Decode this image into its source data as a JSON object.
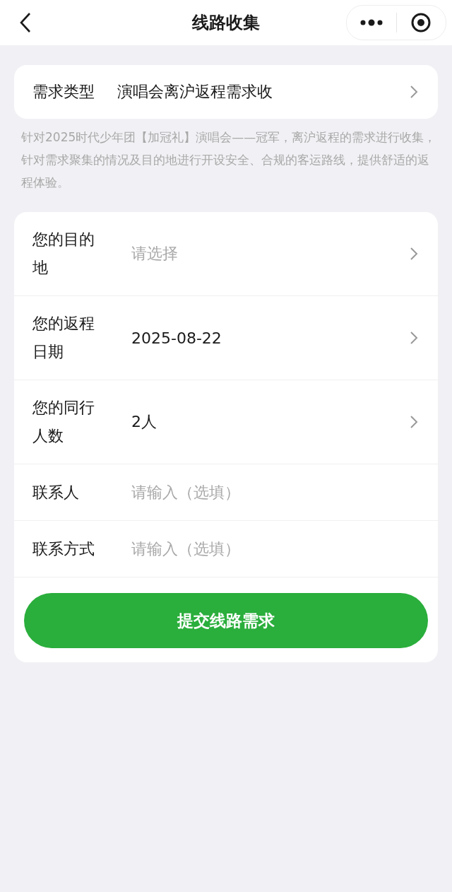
{
  "nav_bar": {
    "title": "线路收集"
  },
  "type_row": {
    "label": "需求类型",
    "value": "演唱会离沪返程需求收"
  },
  "description": "针对2025时代少年团【加冠礼】演唱会——冠军，离沪返程的需求进行收集，针对需求聚集的情况及目的地进行开设安全、合规的客运路线，提供舒适的返程体验。",
  "form_rows": [
    {
      "kind": "picker",
      "label": "您的目的地",
      "placeholder": "请选择"
    },
    {
      "kind": "picker",
      "label": "您的返程日期",
      "value": "2025-08-22"
    },
    {
      "kind": "picker",
      "label": "您的同行人数",
      "value": "2人"
    },
    {
      "kind": "input",
      "label": "联系人",
      "placeholder": "请输入（选填）"
    },
    {
      "kind": "input",
      "label": "联系方式",
      "placeholder": "请输入（选填）"
    }
  ],
  "submit_button": "提交线路需求"
}
